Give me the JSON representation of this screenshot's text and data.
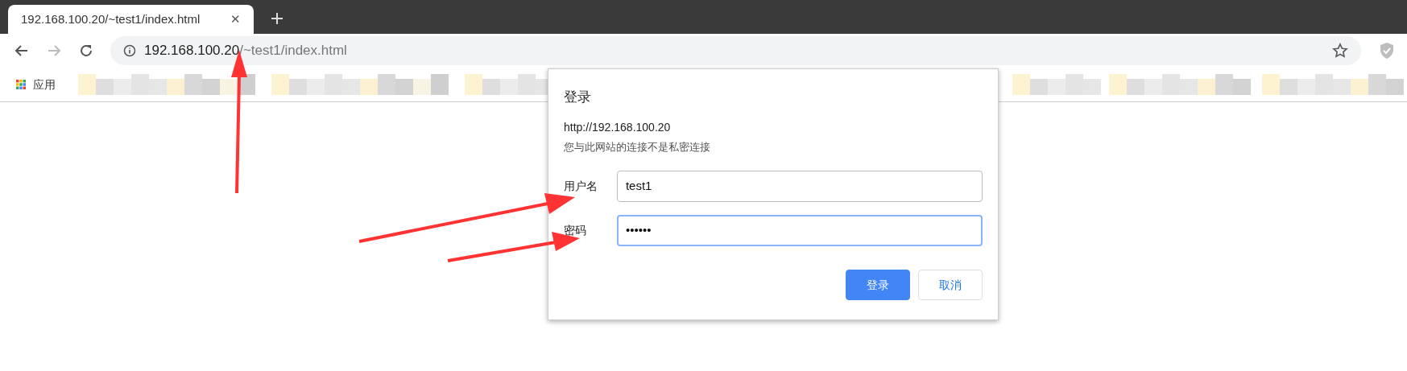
{
  "tab": {
    "title": "192.168.100.20/~test1/index.html",
    "close": "✕"
  },
  "address_bar": {
    "host": "192.168.100.20",
    "path": "/~test1/index.html"
  },
  "bookmarks": {
    "apps_label": "应用"
  },
  "dialog": {
    "title": "登录",
    "origin": "http://192.168.100.20",
    "warning": "您与此网站的连接不是私密连接",
    "fields": [
      {
        "label": "用户名",
        "value": "test1",
        "focused": false
      },
      {
        "label": "密码",
        "value": "••••••",
        "focused": true
      }
    ],
    "buttons": [
      {
        "label": "登录",
        "kind": "primary"
      },
      {
        "label": "取消",
        "kind": "secondary"
      }
    ]
  }
}
